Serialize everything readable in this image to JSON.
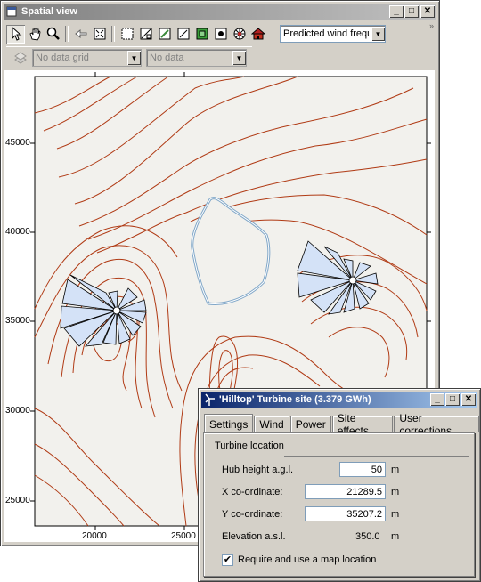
{
  "spatial_view": {
    "title": "Spatial view",
    "toolbar": {
      "tools": [
        "select-arrow-icon",
        "hand-pan-icon",
        "zoom-magnifier-icon",
        "back-arrow-icon",
        "fit-extent-icon",
        "grid-cells-icon",
        "grid-resource-icon",
        "grid-edit-icon",
        "grid-blank-icon",
        "grid-green-icon",
        "grid-toggle-icon",
        "wind-rose-tool-icon",
        "house-obstacle-icon"
      ],
      "layer_combo": "Predicted wind frequ",
      "grid_combo": "No data grid",
      "data_combo": "No data"
    },
    "plot": {
      "y_ticks": [
        "45000",
        "40000",
        "35000",
        "30000",
        "25000"
      ],
      "x_ticks": [
        "20000",
        "25000"
      ]
    }
  },
  "turbine_dialog": {
    "title": "'Hilltop' Turbine site (3.379 GWh)",
    "tabs": [
      "Settings",
      "Wind",
      "Power",
      "Site effects",
      "User corrections"
    ],
    "active_tab": "Settings",
    "group_title": "Turbine location",
    "fields": {
      "hub_height": {
        "label": "Hub height a.g.l.",
        "value": "50",
        "unit": "m"
      },
      "x_coord": {
        "label": "X co-ordinate:",
        "value": "21289.5",
        "unit": "m"
      },
      "y_coord": {
        "label": "Y co-ordinate:",
        "value": "35207.2",
        "unit": "m"
      },
      "elevation": {
        "label": "Elevation a.s.l.",
        "value": "350.0",
        "unit": "m"
      }
    },
    "checkbox": {
      "label": "Require and use a map location",
      "checked": true
    }
  },
  "colors": {
    "contour": "#b03a14",
    "lake": "#7fa6c8",
    "rose_fill": "#d4e2f7",
    "plot_bg": "#f2f1ed"
  }
}
